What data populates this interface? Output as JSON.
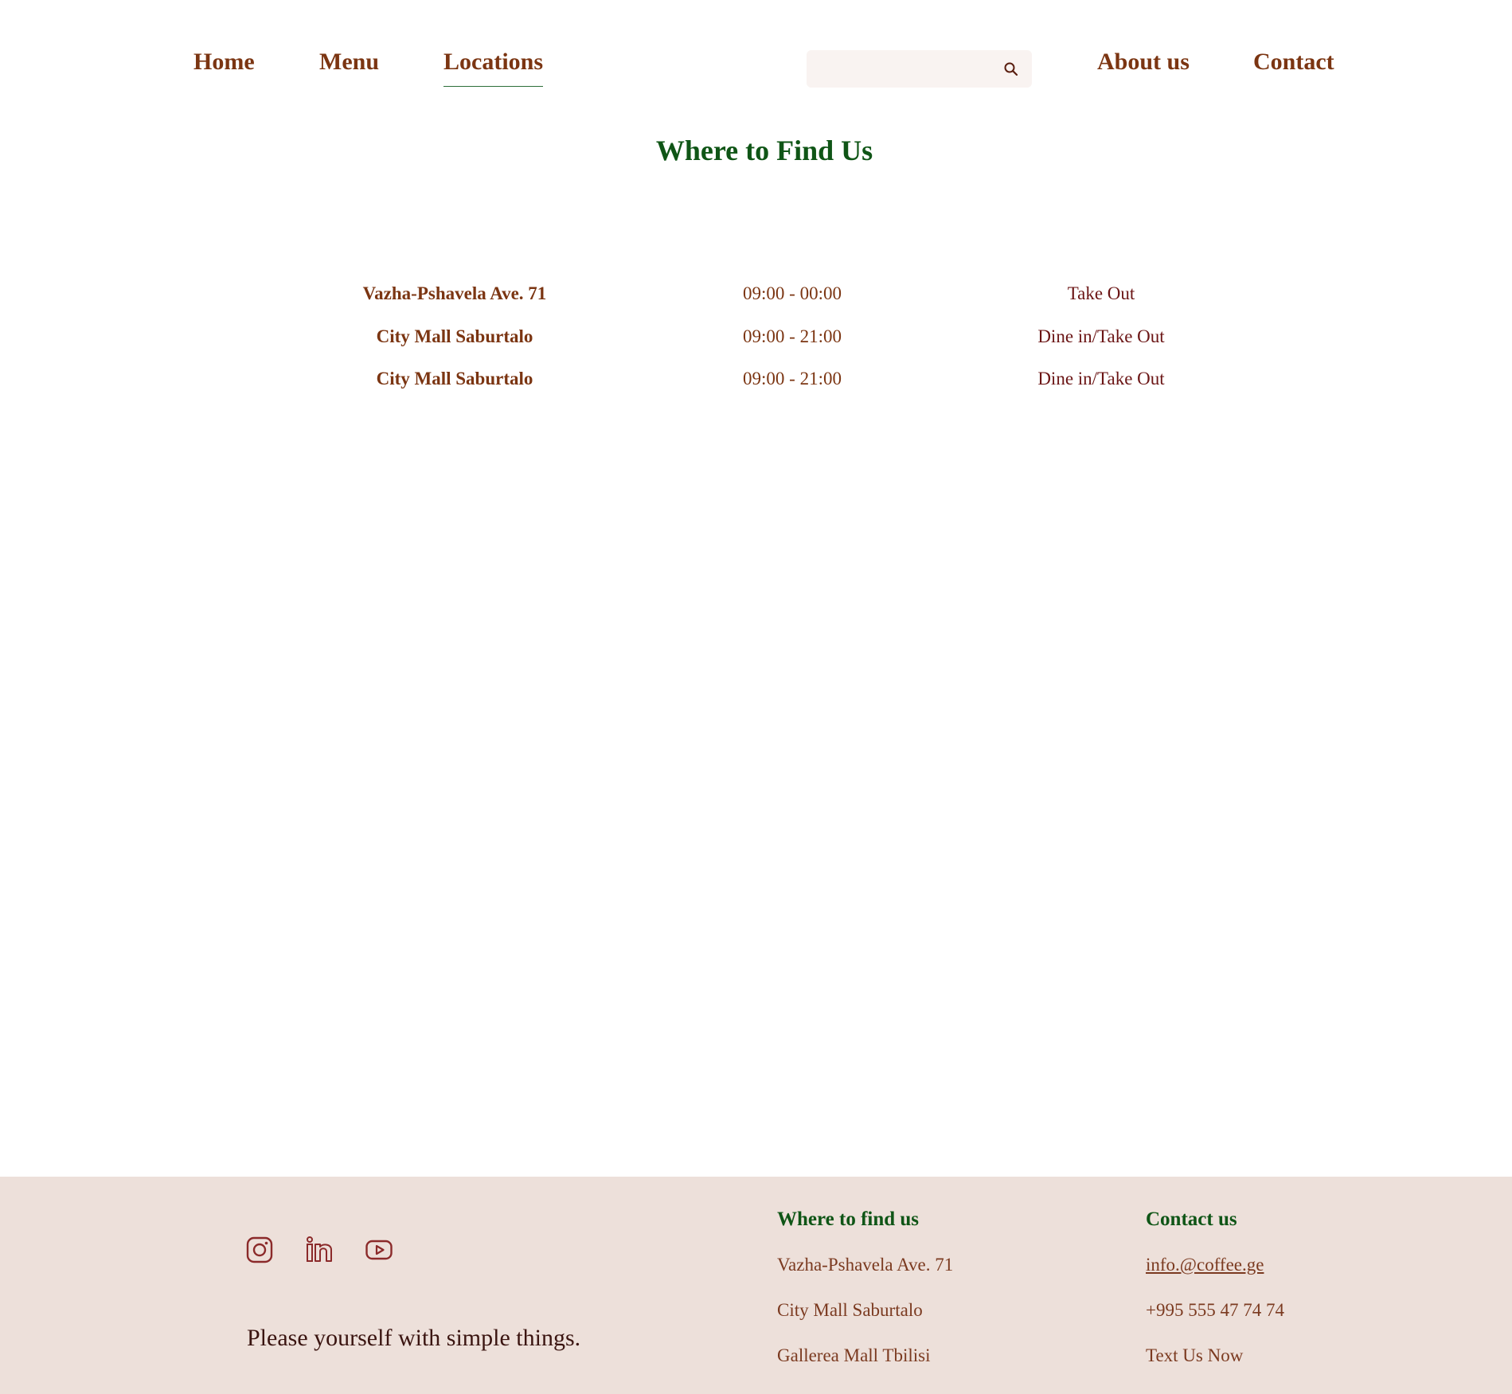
{
  "nav": {
    "home": "Home",
    "menu": "Menu",
    "locations": "Locations",
    "about": "About us",
    "contact": "Contact",
    "active": "locations"
  },
  "search": {
    "placeholder": "",
    "icon": "search-icon"
  },
  "main": {
    "title": "Where to Find Us",
    "locations": [
      {
        "name": "Vazha-Pshavela Ave. 71",
        "hours": "09:00 - 00:00",
        "service": "Take Out"
      },
      {
        "name": "City Mall Saburtalo",
        "hours": "09:00 - 21:00",
        "service": "Dine in/Take Out"
      },
      {
        "name": "City Mall Saburtalo",
        "hours": "09:00 - 21:00",
        "service": "Dine in/Take Out"
      }
    ]
  },
  "footer": {
    "social": [
      "instagram-icon",
      "linkedin-icon",
      "youtube-icon"
    ],
    "tagline": "Please yourself with simple things.",
    "find": {
      "title": "Where to find us",
      "items": [
        "Vazha-Pshavela Ave. 71",
        "City Mall Saburtalo",
        "Gallerea Mall Tbilisi"
      ]
    },
    "contact": {
      "title": "Contact us",
      "email": "info.@coffee.ge",
      "phone": "+995 555 47 74 74",
      "text": "Text Us Now"
    }
  },
  "colors": {
    "brown": "#7b3512",
    "green": "#0f5516",
    "maroon": "#6b1515",
    "footer_bg": "#ede0da",
    "search_bg": "#f9f3f1"
  }
}
